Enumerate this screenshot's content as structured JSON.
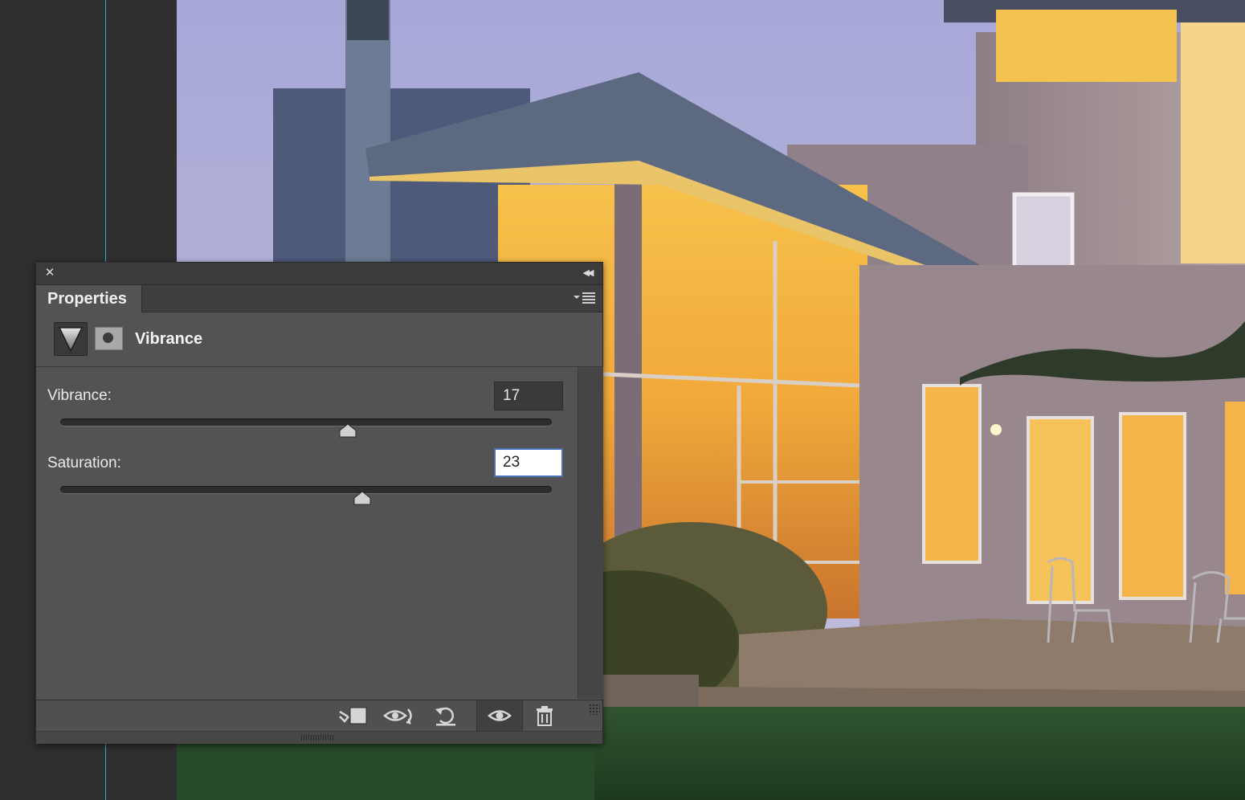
{
  "panel": {
    "tab_label": "Properties",
    "adjustment_title": "Vibrance"
  },
  "controls": {
    "vibrance": {
      "label": "Vibrance:",
      "value": "17",
      "slider_fraction": 0.585
    },
    "saturation": {
      "label": "Saturation:",
      "value": "23",
      "slider_fraction": 0.615
    }
  },
  "footer": {
    "buttons": [
      "clip-to-layer-icon",
      "view-previous-state-icon",
      "reset-icon",
      "visibility-eye-icon",
      "trash-icon"
    ]
  },
  "colors": {
    "panel_bg": "#535353",
    "focus_border": "#4b74b8",
    "guide": "#1fb8c4"
  }
}
